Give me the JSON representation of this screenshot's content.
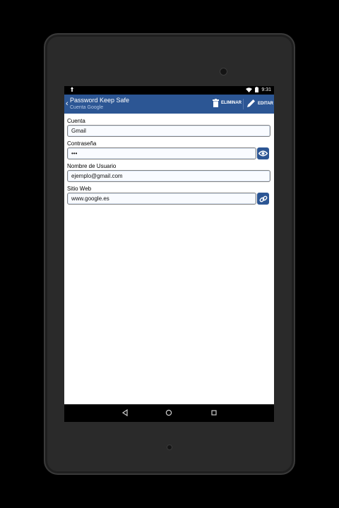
{
  "status_bar": {
    "time": "9:31"
  },
  "app_bar": {
    "title": "Password Keep Safe",
    "subtitle": "Cuenta Google",
    "delete_label": "ELIMINAR",
    "edit_label": "EDITAR"
  },
  "form": {
    "account": {
      "label": "Cuenta",
      "value": "Gmail"
    },
    "password": {
      "label": "Contraseña",
      "value": "•••"
    },
    "username": {
      "label": "Nombre de Usuario",
      "value": "ejemplo@gmail.com"
    },
    "website": {
      "label": "Sitio Web",
      "value": "www.google.es"
    }
  },
  "icons": {
    "show_password": "eye-icon",
    "open_link": "link-icon",
    "delete": "trash-icon",
    "edit": "pencil-icon",
    "nav_back": "back-triangle-icon",
    "nav_home": "home-circle-icon",
    "nav_recents": "recents-square-icon"
  },
  "colors": {
    "app_bar": "#2c5694",
    "field_border": "#808080"
  }
}
